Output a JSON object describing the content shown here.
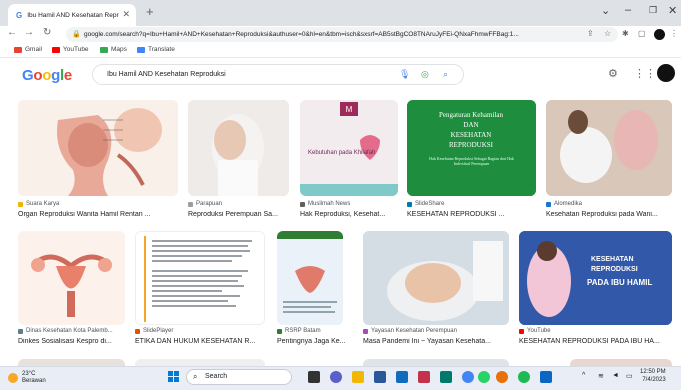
{
  "browser": {
    "tab_title": "Ibu Hamil AND Kesehatan Repro",
    "url": "google.com/search?q=Ibu+Hamil+AND+Kesehatan+Reproduksi&authuser=0&hl=en&tbm=isch&sxsrf=AB5stBgCO8TNAruJyFEi-QNxaFhmwFFBag:1..."
  },
  "bookmarks": [
    {
      "label": "Gmail",
      "color": "#ea4335"
    },
    {
      "label": "YouTube",
      "color": "#ff0000"
    },
    {
      "label": "Maps",
      "color": "#34a853"
    },
    {
      "label": "Translate",
      "color": "#4285f4"
    }
  ],
  "search": {
    "logo": "Google",
    "query": "Ibu Hamil AND Kesehatan Reproduksi"
  },
  "results": [
    {
      "source": "Suara Karya",
      "caption": "Organ Reproduksi Wanita Hamil Rentan ...",
      "fav_color": "#f4b400"
    },
    {
      "source": "Parapuan",
      "caption": "Reproduksi Perempuan Sa...",
      "fav_color": "#9e9e9e"
    },
    {
      "source": "Muslimah News",
      "caption": "Hak Reproduksi, Kesehat...",
      "fav_color": "#616161"
    },
    {
      "source": "SlideShare",
      "caption": "KESEHATAN REPRODUKSI ...",
      "fav_color": "#0077b5"
    },
    {
      "source": "Alomedika",
      "caption": "Kesehatan Reproduksi pada Wani...",
      "fav_color": "#1976d2"
    },
    {
      "source": "Dinas Kesehatan Kota Palemb...",
      "caption": "Dinkes Sosialisasi Kespro di...",
      "fav_color": "#607d8b"
    },
    {
      "source": "SlidePlayer",
      "caption": "ETIKA DAN HUKUM KESEHATAN R...",
      "fav_color": "#e65100"
    },
    {
      "source": "RSRP Batam",
      "caption": "Pentingnya Jaga Ke...",
      "fav_color": "#2e7d32"
    },
    {
      "source": "Yayasan Kesehatan Perempuan",
      "caption": "Masa Pandemi Ini ~ Yayasan Kesehata...",
      "fav_color": "#ab47bc"
    },
    {
      "source": "YouTube",
      "caption": "KESEHATAN REPRODUKSI PADA IBU HA...",
      "fav_color": "#ff0000"
    }
  ],
  "image_text": {
    "r3_title_1": "Pengaturan Kehamilan",
    "r3_title_2": "DAN",
    "r3_title_3": "KESEHATAN",
    "r3_title_4": "REPRODUKSI",
    "r3_sub": "Hak Kesehatan Reproduksi Sebagai Bagian dari Hak Individual Perempuan",
    "r2_title": "Kebutuhan pada Khilafah",
    "r9_title_1": "KESEHATAN",
    "r9_title_2": "REPRODUKSI",
    "r9_title_3": "PADA IBU HAMIL"
  },
  "taskbar": {
    "weather_temp": "23°C",
    "weather_desc": "Berawan",
    "search_label": "Search",
    "time": "12:50 PM",
    "date": "7/4/2023"
  }
}
